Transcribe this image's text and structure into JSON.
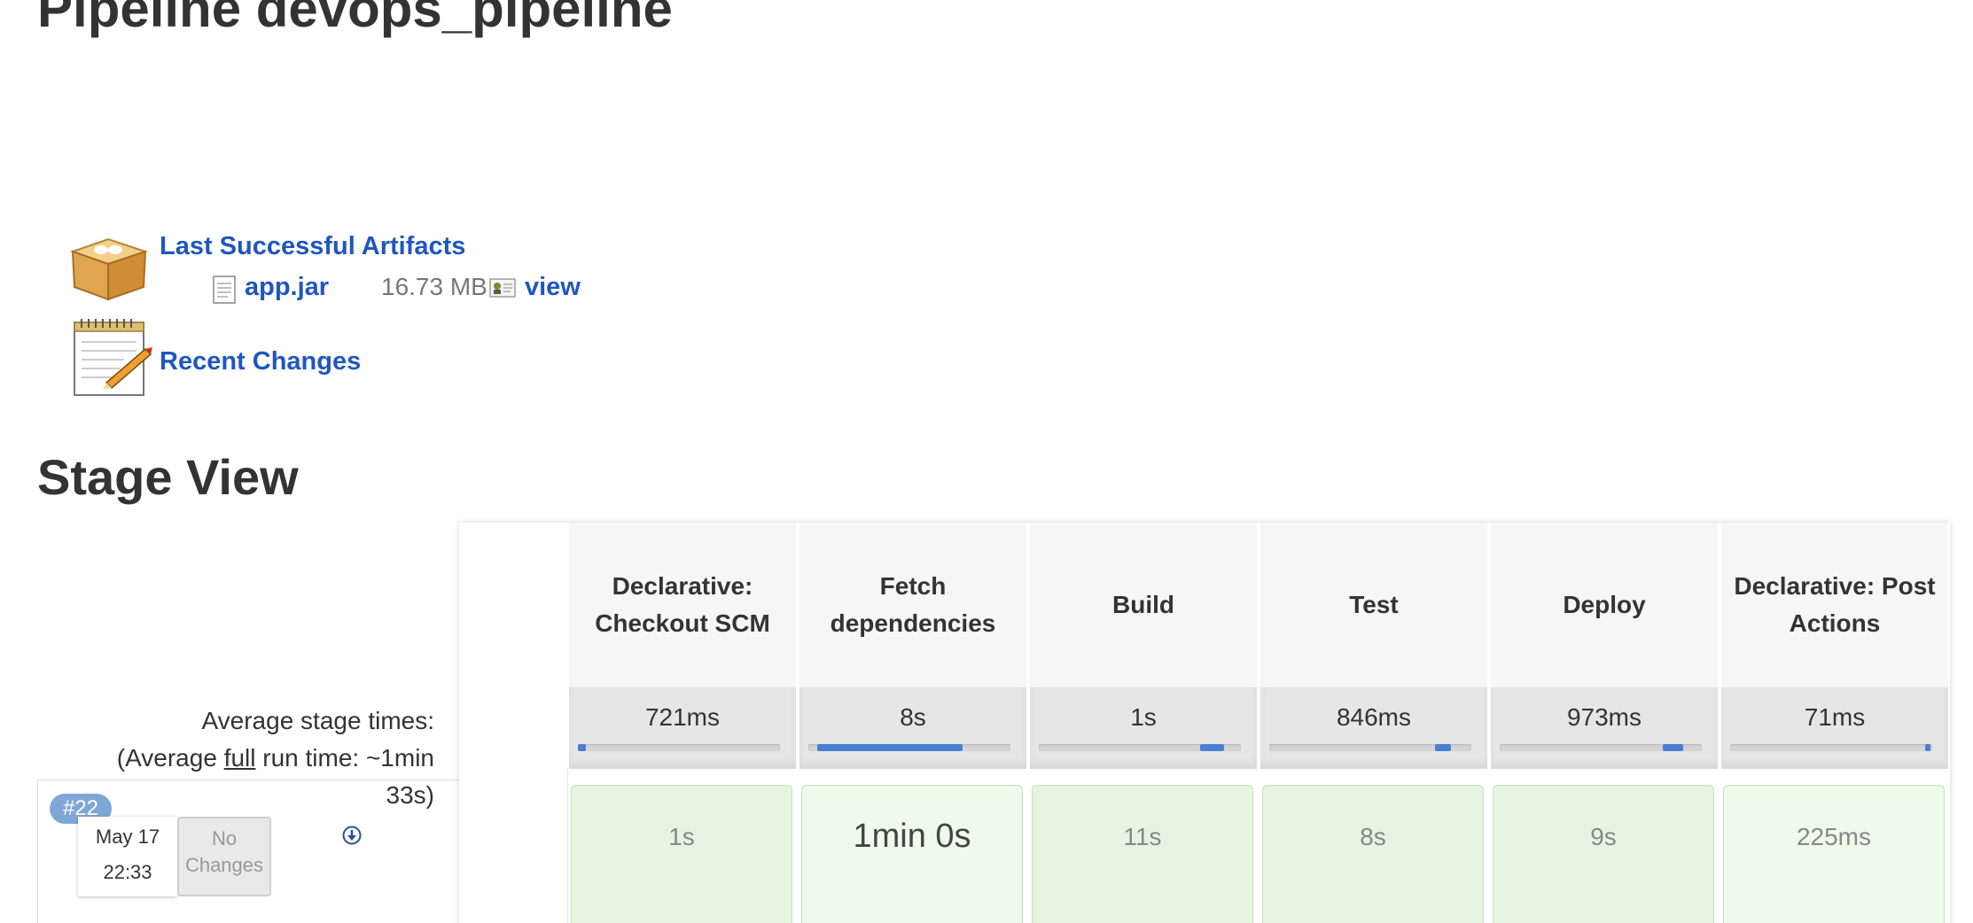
{
  "page": {
    "title": "Pipeline devops_pipeline"
  },
  "artifacts": {
    "heading": "Last Successful Artifacts",
    "file_name": "app.jar",
    "file_size": "16.73 MB",
    "view_label": "view"
  },
  "recent_changes": {
    "label": "Recent Changes"
  },
  "stage_view": {
    "title": "Stage View",
    "avg_label": "Average stage times:",
    "avg_full_prefix": "(Average ",
    "avg_full_word": "full",
    "avg_full_suffix": " run time: ~1min",
    "avg_full_line2": "33s)",
    "stages": [
      {
        "name": "Declarative: Checkout SCM",
        "avg": "721ms",
        "bar_fraction": 0.04,
        "run": "1s"
      },
      {
        "name": "Fetch dependencies",
        "avg": "8s",
        "bar_fraction": 0.72,
        "run": "1min 0s"
      },
      {
        "name": "Build",
        "avg": "1s",
        "bar_fraction": 0.12,
        "run": "11s"
      },
      {
        "name": "Test",
        "avg": "846ms",
        "bar_fraction": 0.08,
        "run": "8s"
      },
      {
        "name": "Deploy",
        "avg": "973ms",
        "bar_fraction": 0.1,
        "run": "9s"
      },
      {
        "name": "Declarative: Post Actions",
        "avg": "71ms",
        "bar_fraction": 0.01,
        "run": "225ms"
      }
    ],
    "run": {
      "id": "#22",
      "date": "May 17",
      "time": "22:33",
      "changes": "No Changes"
    }
  },
  "colors": {
    "link": "#1f57bf",
    "badge": "#7fa7d6",
    "success_cell": "#e6f5e1",
    "bar_fill": "#4a7fd4"
  }
}
